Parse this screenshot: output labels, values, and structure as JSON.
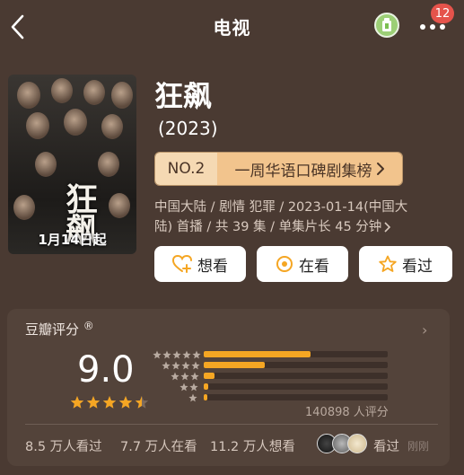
{
  "header": {
    "title": "电视",
    "notification_count": "12"
  },
  "poster": {
    "title": "狂飙",
    "date": "1月14日起"
  },
  "show": {
    "name": "狂飙",
    "year": "(2023)",
    "rank_no": "NO.2",
    "rank_list": "一周华语口碑剧集榜 ",
    "meta_line1": "中国大陆 / 剧情 犯罪 / 2023-01-14(中国大",
    "meta_line2": "陆) 首播 / 共 39 集 / 单集片长 45 分钟 "
  },
  "actions": {
    "want": "想看",
    "watching": "在看",
    "watched": "看过"
  },
  "rating": {
    "label": "豆瓣评分",
    "mark": "®",
    "score": "9.0",
    "score_stars": 4.5,
    "distribution": [
      0.58,
      0.33,
      0.06,
      0.025,
      0.015
    ],
    "count_text": "140898 人评分",
    "watched_stat": "8.5 万人看过",
    "watching_stat": "7.7 万人在看",
    "want_stat": "11.2 万人想看",
    "activity_text": "看过",
    "activity_time": "刚刚"
  },
  "colors": {
    "background": "#4a3a32",
    "accent": "#f5a623",
    "rank_badge": "#f2c48d"
  }
}
